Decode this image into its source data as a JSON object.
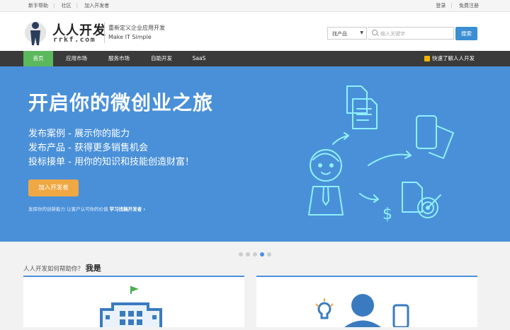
{
  "topbar": {
    "left": [
      "新手帮助",
      "社区",
      "加入开发者"
    ],
    "right": [
      "登录",
      "免费注册"
    ]
  },
  "header": {
    "brand": "人人开发",
    "brand_sub": "rrkf.com",
    "slogan_cn": "重新定义企业应用开发",
    "slogan_en": "Make  IT  Simple",
    "search": {
      "category": "找产品",
      "placeholder": "输入关键字",
      "button": "搜索"
    }
  },
  "nav": {
    "items": [
      "首页",
      "应用市场",
      "服务市场",
      "自助开发",
      "SaaS"
    ],
    "active": "首页",
    "right": "快速了解人人开发"
  },
  "hero": {
    "title": "开启你的微创业之旅",
    "lines": [
      "发布案例 - 展示你的能力",
      "发布产品 - 获得更多销售机会",
      "投标接单 - 用你的知识和技能创造财富！"
    ],
    "button": "加入开发者",
    "foot_text": "发挥你的创新能力   让客户认可你的价值",
    "foot_link": "学习找稿开发者 ›"
  },
  "carousel": {
    "count": 5,
    "active": 4
  },
  "section": {
    "question": "人人开发如何帮助你？",
    "emphasis": "我是"
  },
  "colors": {
    "nav_bg": "#3a3a3a",
    "active": "#5cb85c",
    "hero": "#4a90d9",
    "cta": "#f0a844"
  }
}
